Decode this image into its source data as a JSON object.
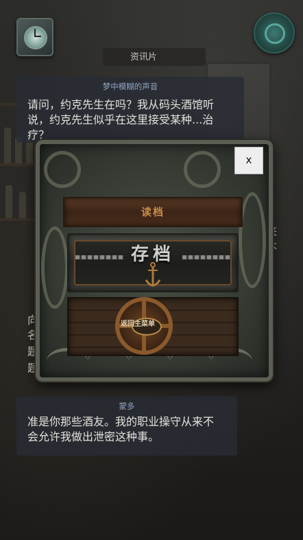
{
  "header": {
    "title": "资讯片"
  },
  "icons": {
    "clock": "clock-icon",
    "medal": "medal-icon"
  },
  "dialogue_1": {
    "speaker": "梦中模糊的声音",
    "lines": [
      "请问，约克先生在吗？我从码头酒馆听",
      "说，约克先生似乎在这里接受某种...治",
      "疗？"
    ]
  },
  "peek_right": [
    "来",
    "怀",
    "。"
  ],
  "peek_left": [
    "向",
    "名",
    "题",
    "题"
  ],
  "menu": {
    "close_label": "x",
    "item_1": "读档",
    "item_2": "存档",
    "item_3": "返回主菜单"
  },
  "dialogue_2": {
    "speaker": "蒙多",
    "lines": [
      "准是你那些酒友。我的职业操守从来不",
      "会允许我做出泄密这种事。"
    ]
  }
}
